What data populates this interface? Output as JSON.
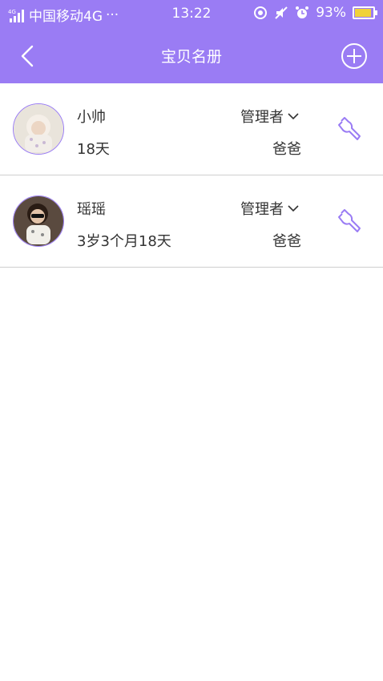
{
  "status_bar": {
    "network_label": "4G",
    "carrier": "中国移动4G",
    "dots": "···",
    "time": "13:22",
    "battery": "93%",
    "icons": [
      "signal-icon",
      "location-icon",
      "mute-icon",
      "alarm-icon",
      "battery-icon"
    ]
  },
  "navbar": {
    "title": "宝贝名册",
    "back_icon": "chevron-left-icon",
    "add_icon": "plus-circle-icon"
  },
  "colors": {
    "accent": "#9a7cf4",
    "divider": "#cfcfcf",
    "text": "#333333"
  },
  "babies": [
    {
      "name": "小帅",
      "age": "18天",
      "role": "管理者",
      "relation": "爸爸"
    },
    {
      "name": "瑶瑶",
      "age": "3岁3个月18天",
      "role": "管理者",
      "relation": "爸爸"
    }
  ]
}
